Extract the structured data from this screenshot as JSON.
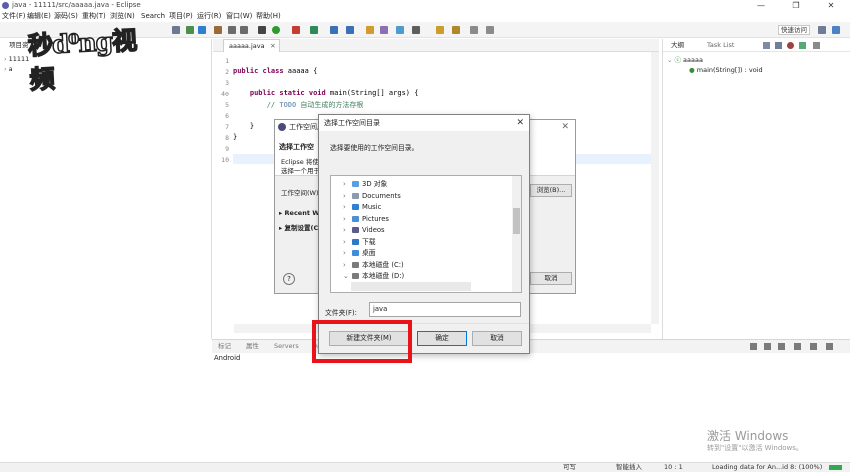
{
  "titlebar": {
    "title": "java - 11111/src/aaaaa.java - Eclipse",
    "minimize": "—",
    "restore": "❐",
    "close": "✕"
  },
  "menu": [
    "文件(F)",
    "编辑(E)",
    "源码(S)",
    "重构(T)",
    "浏览(N)",
    "Search",
    "项目(P)",
    "运行(R)",
    "窗口(W)",
    "帮助(H)"
  ],
  "toolbar": {
    "quick_access": "快速访问"
  },
  "watermark": {
    "text": "秒d⁰ng视频"
  },
  "left_panel": {
    "tab_label": "项目资",
    "items": [
      "11111",
      "a"
    ]
  },
  "editor": {
    "tab_label": "aaaaa.java",
    "line_numbers": [
      "1",
      "2",
      "3",
      "4⊖",
      "5",
      "6",
      "7",
      "8",
      "9",
      "10"
    ],
    "lines": [
      {
        "kw": "",
        "text": ""
      },
      {
        "kw": "public class",
        "text": " aaaaa {"
      },
      {
        "kw": "",
        "text": ""
      },
      {
        "kw": "    public static void",
        "text": " main(String[] args) {"
      },
      {
        "kw": "",
        "todo": "TODO",
        "pre": "        // ",
        "comment": " 自动生成的方法存根"
      },
      {
        "kw": "",
        "text": ""
      },
      {
        "kw": "",
        "text": "    }"
      },
      {
        "kw": "",
        "text": "}"
      },
      {
        "kw": "",
        "text": ""
      },
      {
        "kw": "",
        "text": ""
      }
    ]
  },
  "outline": {
    "tab_outline": "大纲",
    "tab_tasks": "Task List",
    "class_name": "aaaaa",
    "method": "main(String[]) : void"
  },
  "bottom_panel": {
    "tabs": [
      "标记",
      "属性",
      "Servers",
      "Da"
    ],
    "content": "Android"
  },
  "activate": {
    "title": "激活 Windows",
    "subtitle": "转到\"设置\"以激活 Windows。"
  },
  "statusbar": {
    "writable": "可写",
    "insert": "智能插入",
    "position": "10 : 1",
    "loading": "Loading data for An...id 8: (100%)"
  },
  "bg_dialog": {
    "title": "工作空间启",
    "heading": "选择工作空",
    "desc1": "Eclipse 将使",
    "desc2": "选择一个用于",
    "workspace_label": "工作空间(W)",
    "browse": "浏览(B)...",
    "recent": "Recent Wo",
    "copy_settings": "复制设置(C",
    "help": "?",
    "cancel": "取消"
  },
  "dialog": {
    "title": "选择工作空间目录",
    "description": "选择要使用的工作空间目录。",
    "tree": [
      {
        "caret": "›",
        "icon": "3d-objects",
        "label": "3D 对象",
        "color": "#5aa0e0"
      },
      {
        "caret": "›",
        "icon": "documents",
        "label": "Documents",
        "color": "#8a9bb0"
      },
      {
        "caret": "›",
        "icon": "music",
        "label": "Music",
        "color": "#2f80d1"
      },
      {
        "caret": "›",
        "icon": "pictures",
        "label": "Pictures",
        "color": "#4a8fd6"
      },
      {
        "caret": "›",
        "icon": "videos",
        "label": "Videos",
        "color": "#5c5c8a"
      },
      {
        "caret": "›",
        "icon": "downloads",
        "label": "下载",
        "color": "#2b79c9"
      },
      {
        "caret": "›",
        "icon": "desktop",
        "label": "桌面",
        "color": "#3c8ddc"
      },
      {
        "caret": "›",
        "icon": "drive-c",
        "label": "本地磁盘 (C:)",
        "color": "#7a7a7a"
      },
      {
        "caret": "⌄",
        "icon": "drive-d",
        "label": "本地磁盘 (D:)",
        "color": "#7a7a7a"
      }
    ],
    "folder_label": "文件夹(F):",
    "folder_value": "java",
    "new_folder": "新建文件夹(M)",
    "ok": "确定",
    "cancel": "取消"
  },
  "colors": {
    "highlight": "#e8141a",
    "keyword": "#7f0055",
    "comment": "#3f7f5f"
  }
}
